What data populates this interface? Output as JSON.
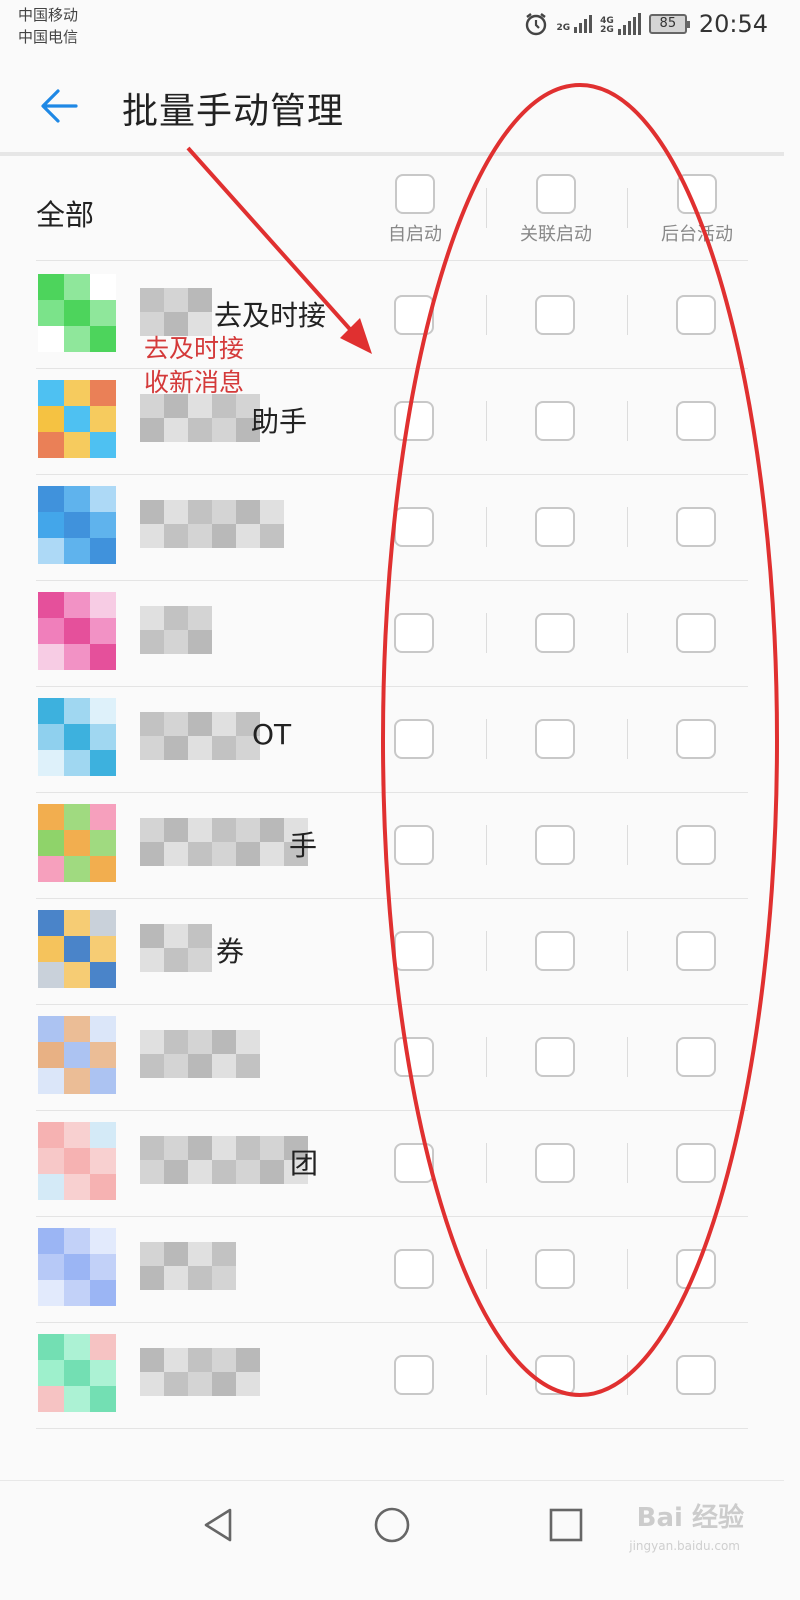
{
  "status_bar": {
    "carrier_1": "中国移动",
    "carrier_2": "中国电信",
    "signal_1_tag": "2G",
    "signal_2_tag_top": "4G",
    "signal_2_tag_bottom": "2G",
    "battery": "85",
    "time": "20:54",
    "icons": [
      "alarm-icon",
      "signal-icon",
      "battery-icon"
    ]
  },
  "header": {
    "title": "批量手动管理",
    "back_icon": "arrow-left-icon"
  },
  "columns": {
    "all_label": "全部",
    "auto_start": "自启动",
    "linked_start": "关联启动",
    "background": "后台活动"
  },
  "apps": [
    {
      "name_visible": "去及时接",
      "icon_colors": [
        "#2ecc40",
        "#7be38a",
        "#ffffff"
      ]
    },
    {
      "name_visible": "助手",
      "icon_colors": [
        "#2fb6f0",
        "#f5c242",
        "#e66a3a"
      ]
    },
    {
      "name_visible": "",
      "icon_colors": [
        "#1e7fd6",
        "#43a6ea",
        "#9fd2f5"
      ]
    },
    {
      "name_visible": "",
      "icon_colors": [
        "#e0318a",
        "#f07fbb",
        "#f6c3df"
      ]
    },
    {
      "name_visible": "OT",
      "icon_colors": [
        "#1ba3d8",
        "#8fd0ee",
        "#d8eef9"
      ]
    },
    {
      "name_visible": "手",
      "icon_colors": [
        "#f0a030",
        "#8fd36a",
        "#f48fb1"
      ]
    },
    {
      "name_visible": "券",
      "icon_colors": [
        "#2a6fc0",
        "#f5c35c",
        "#bfc9d3"
      ]
    },
    {
      "name_visible": "",
      "icon_colors": [
        "#9db8f0",
        "#e8b184",
        "#d5e2f8"
      ]
    },
    {
      "name_visible": "团",
      "icon_colors": [
        "#f5a4a4",
        "#f7c8c8",
        "#cde6f6"
      ]
    },
    {
      "name_visible": "",
      "icon_colors": [
        "#8aa8f2",
        "#b7c9f7",
        "#dde6fb"
      ]
    },
    {
      "name_visible": "",
      "icon_colors": [
        "#5ad9a6",
        "#9ef0cc",
        "#f5b8b8"
      ]
    }
  ],
  "annotation": {
    "text_line_1": "去及时接",
    "text_line_2": "收新消息",
    "color": "#d43a3a"
  },
  "nav_bar": {
    "icons": [
      "back-triangle-icon",
      "home-circle-icon",
      "recent-square-icon"
    ]
  },
  "watermark": {
    "text": "Bai 经验",
    "sub": "jingyan.baidu.com"
  }
}
